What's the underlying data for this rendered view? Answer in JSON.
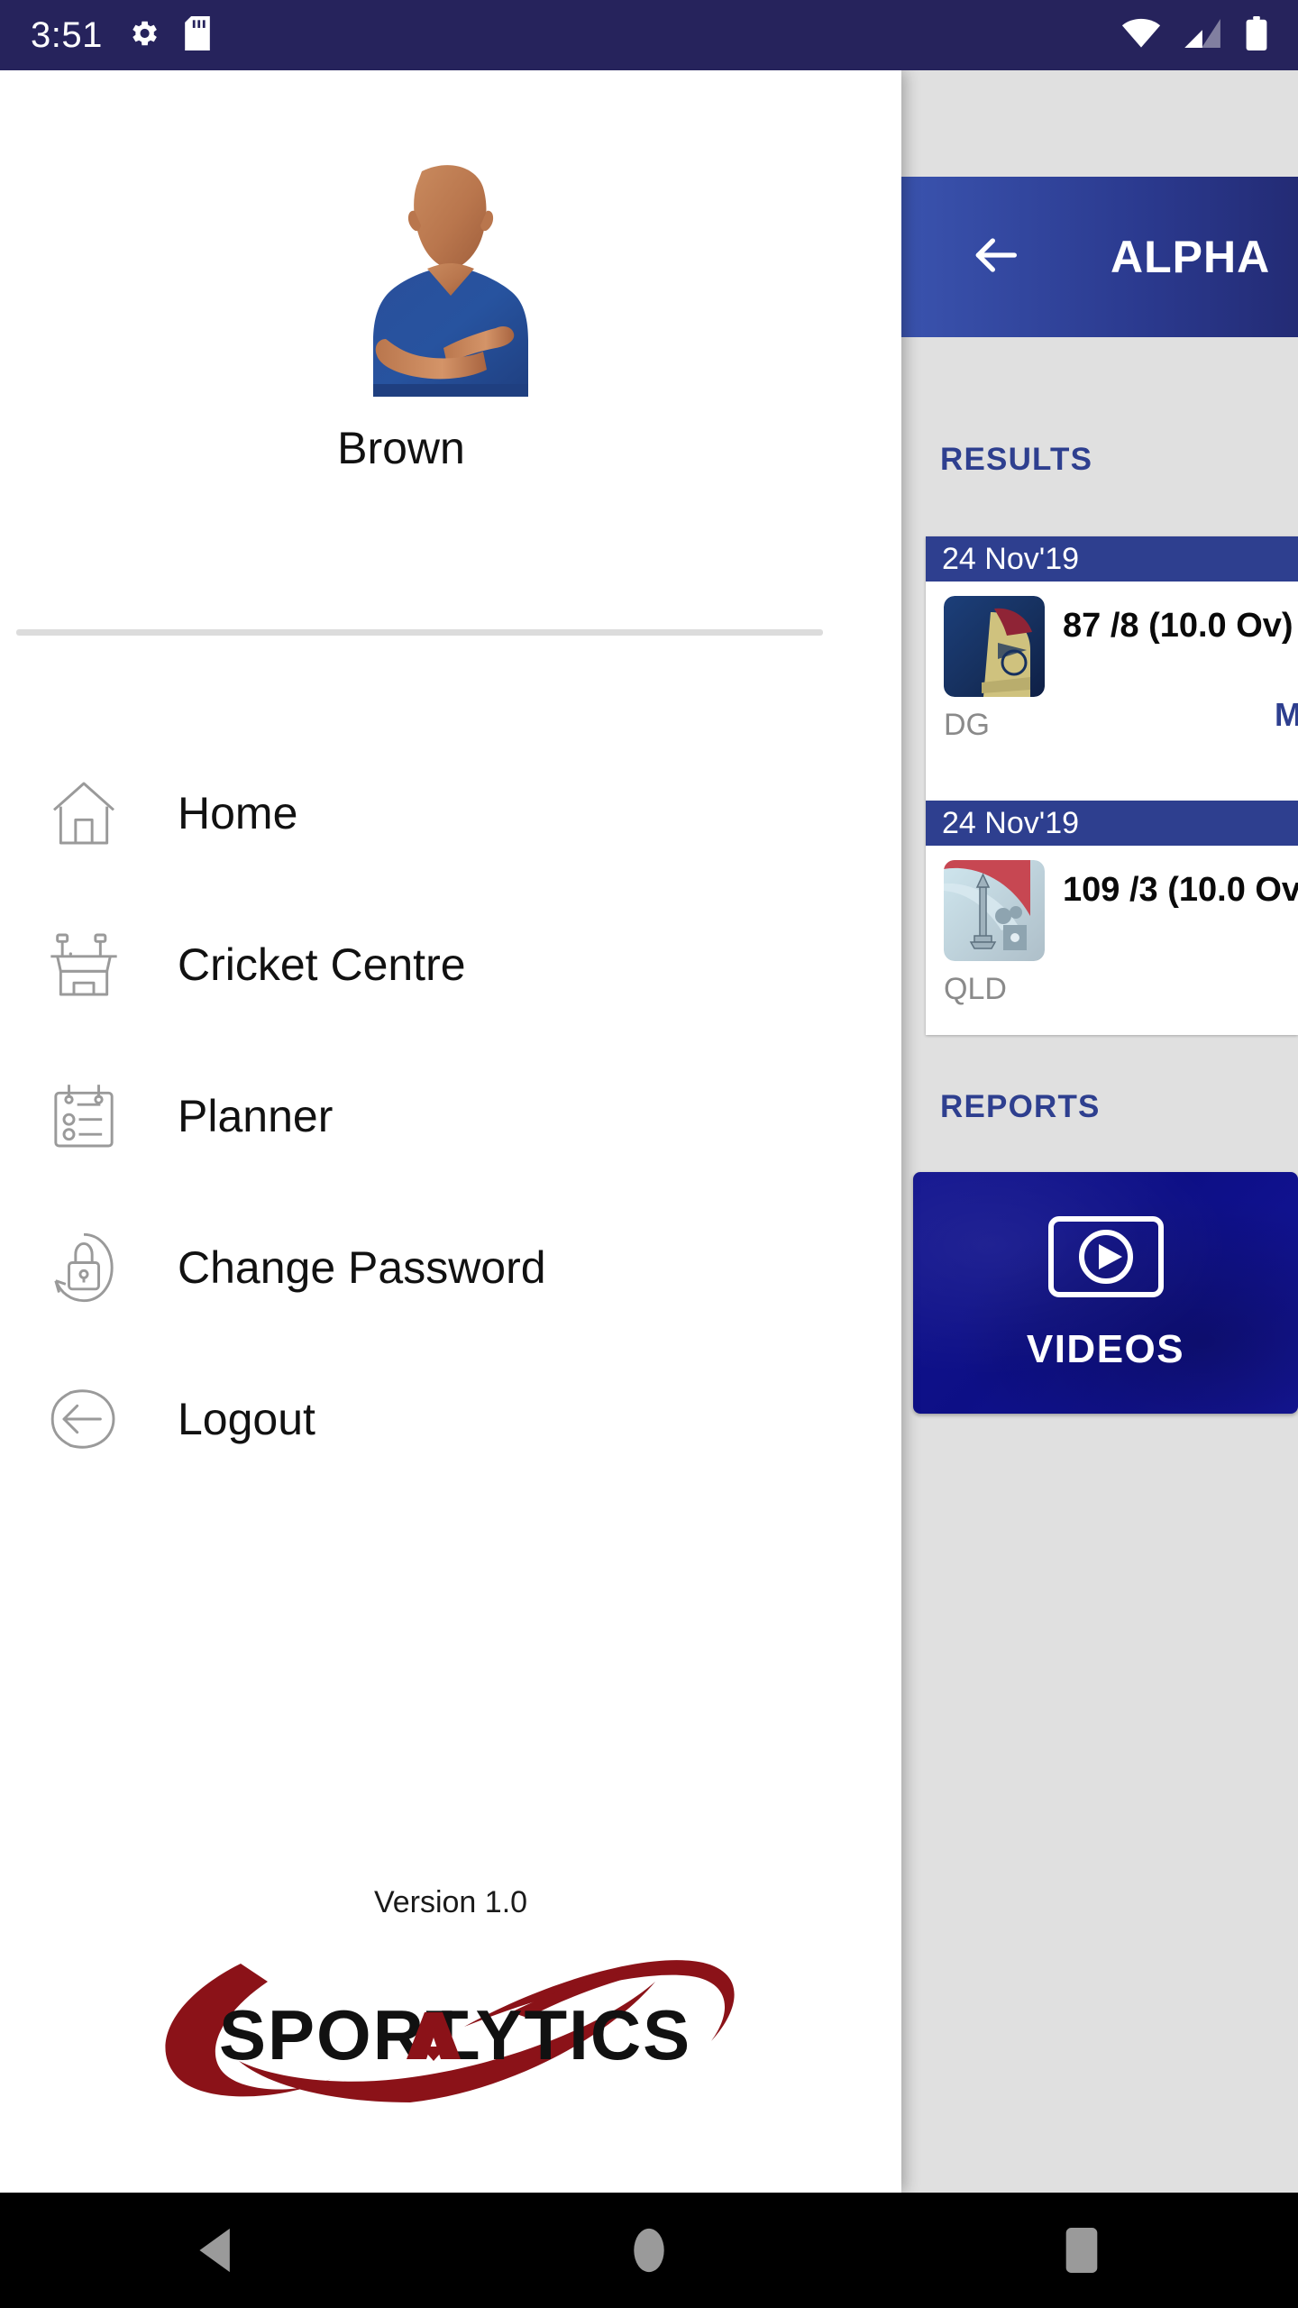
{
  "status_bar": {
    "time": "3:51",
    "icons": [
      "gear-icon",
      "sd-card-icon",
      "wifi-icon",
      "cellular-signal-icon",
      "battery-icon"
    ]
  },
  "drawer": {
    "profile": {
      "name": "Brown",
      "avatar": "user-avatar"
    },
    "menu_items": [
      {
        "label": "Home",
        "icon": "home-icon"
      },
      {
        "label": "Cricket Centre",
        "icon": "cricket-scoreboard-icon"
      },
      {
        "label": "Planner",
        "icon": "calendar-planner-icon"
      },
      {
        "label": "Change Password",
        "icon": "lock-refresh-icon"
      },
      {
        "label": "Logout",
        "icon": "logout-arrow-icon"
      }
    ],
    "footer": {
      "version": "Version 1.0",
      "logo_text": "SPORTALYTICS"
    }
  },
  "main_screen": {
    "appbar": {
      "title": "ALPHA",
      "back_icon": "back-arrow-icon"
    },
    "sections": {
      "results_label": "RESULTS",
      "reports_label": "REPORTS"
    },
    "results": [
      {
        "date": "24 Nov'19",
        "score": "87 /8 (10.0 Ov)",
        "team_code": "DG",
        "link_label": "M"
      },
      {
        "date": "24 Nov'19",
        "score": "109 /3 (10.0 Ov",
        "team_code": "QLD",
        "link_label": ""
      }
    ],
    "reports": [
      {
        "label": "VIDEOS",
        "icon": "video-player-icon"
      }
    ]
  },
  "nav_bar": {
    "back": "back-triangle-icon",
    "home": "home-circle-icon",
    "recents": "recents-square-icon"
  },
  "colors": {
    "status_bar": "#26235c",
    "appbar_start": "#3a53ae",
    "appbar_end": "#232b75",
    "accent_navy": "#2e3f8f",
    "videos_tile": "#12148f",
    "page_bg": "#e0e0e0",
    "logo_red": "#8b1218"
  }
}
